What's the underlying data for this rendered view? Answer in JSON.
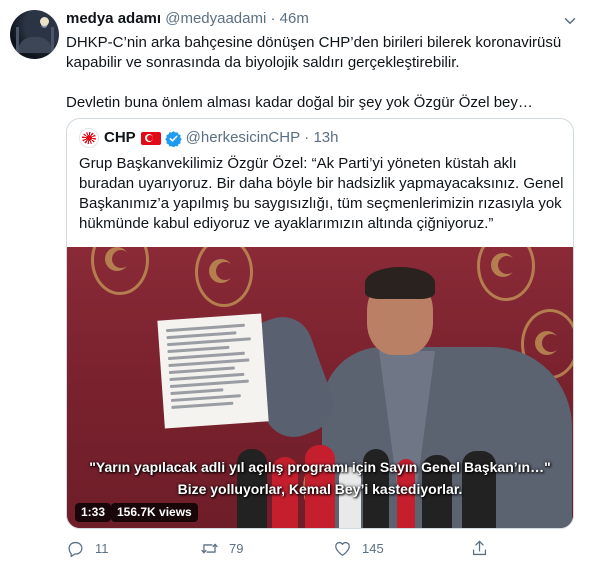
{
  "tweet": {
    "author_name": "medya adamı",
    "author_handle": "@medyaadami",
    "separator": "·",
    "time": "46m",
    "paragraph1": "DHKP-C’nin arka bahçesine dönüşen CHP’den birileri bilerek koronavirüsü kapabilir ve sonrasında da biyolojik saldırı gerçekleştirebilir.",
    "paragraph2": "Devletin buna önlem alması kadar doğal bir şey yok Özgür Özel bey…"
  },
  "quote": {
    "author_name": "CHP",
    "author_handle": "@herkesicinCHP",
    "separator": "·",
    "time": "13h",
    "text": "Grup Başkanvekilimiz Özgür Özel: “Ak Parti’yi yöneten küstah aklı buradan uyarıyoruz. Bir daha böyle bir hadsizlik yapmayacaksınız. Genel Başkanımız’a yapılmış bu saygısızlığı, tüm seçmenlerimizin rızasıyla yok hükmünde kabul ediyoruz ve ayaklarımızın altında çiğniyoruz.”",
    "video": {
      "subtitle_line1": "\"Yarın yapılacak adli yıl açılış programı için Sayın Genel Başkan’ın…\"",
      "subtitle_line2": "Bize yolluyorlar, Kemal Bey’i kastediyorlar.",
      "duration": "1:33",
      "views": "156.7K views"
    }
  },
  "actions": {
    "reply_count": "11",
    "retweet_count": "79",
    "like_count": "145"
  },
  "colors": {
    "text_primary": "#0f1419",
    "text_secondary": "#5b7083",
    "border": "#cfd9de",
    "verified": "#1d9bf0",
    "video_wall": "#7d2430"
  },
  "icons": [
    "more-icon",
    "verified-icon",
    "reply-icon",
    "retweet-icon",
    "like-icon",
    "share-icon"
  ]
}
